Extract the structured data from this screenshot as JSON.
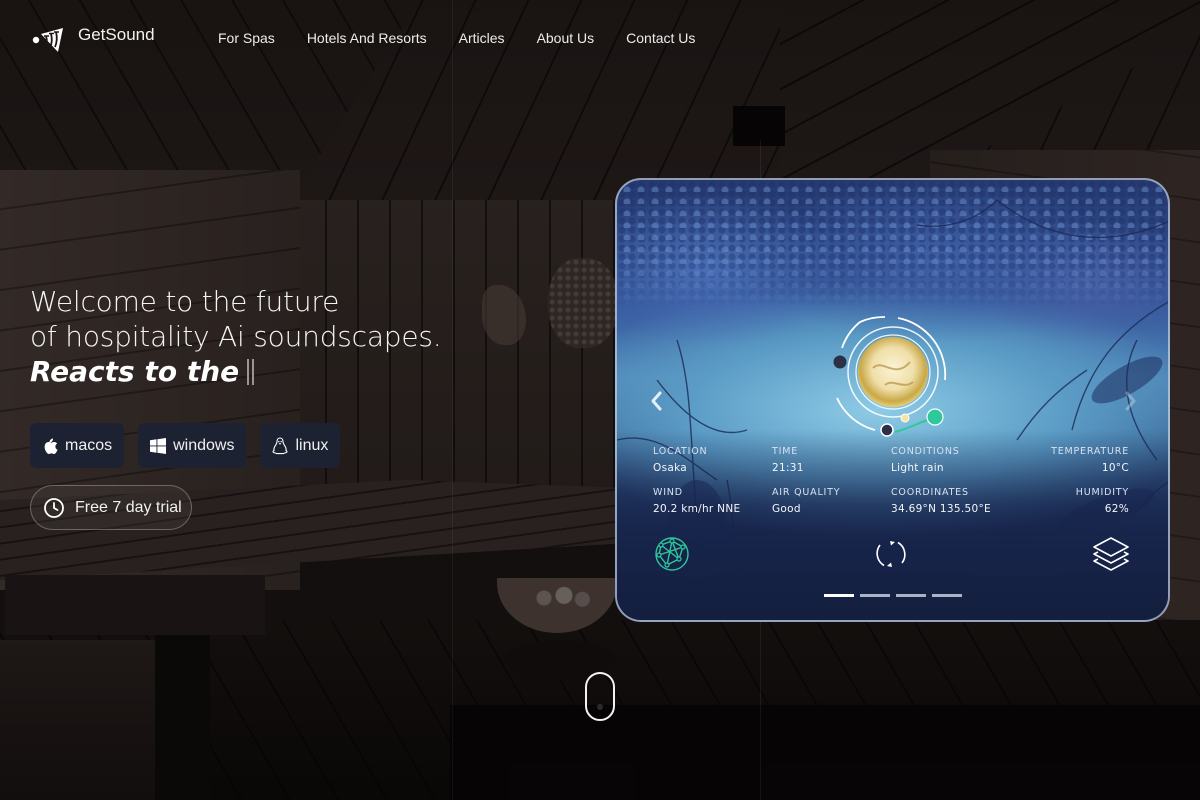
{
  "brand": {
    "name": "GetSound",
    "icon": "getsound-logo-icon"
  },
  "nav": {
    "items": [
      {
        "label": "For Spas"
      },
      {
        "label": "Hotels And Resorts"
      },
      {
        "label": "Articles"
      },
      {
        "label": "About Us"
      },
      {
        "label": "Contact Us"
      }
    ]
  },
  "hero": {
    "line1": "Welcome to the future",
    "line2": "of hospitality Ai soundscapes.",
    "typed": "Reacts to the",
    "cursor": "text-cursor"
  },
  "downloads": [
    {
      "label": "macos",
      "icon": "apple-icon"
    },
    {
      "label": "windows",
      "icon": "windows-icon"
    },
    {
      "label": "linux",
      "icon": "linux-penguin-icon"
    }
  ],
  "trial": {
    "label": "Free 7 day trial",
    "icon": "clock-icon"
  },
  "weather_card": {
    "stats": {
      "location": {
        "label": "LOCATION",
        "value": "Osaka"
      },
      "time": {
        "label": "TIME",
        "value": "21:31"
      },
      "conditions": {
        "label": "CONDITIONS",
        "value": "Light rain"
      },
      "temperature": {
        "label": "TEMPERATURE",
        "value": "10°C"
      },
      "wind": {
        "label": "WIND",
        "value": "20.2 km/hr NNE"
      },
      "air_quality": {
        "label": "AIR QUALITY",
        "value": "Good"
      },
      "coordinates": {
        "label": "COORDINATES",
        "value": "34.69°N 135.50°E"
      },
      "humidity": {
        "label": "HUMIDITY",
        "value": "62%"
      }
    },
    "icons": [
      "network-globe-icon",
      "refresh-icon",
      "layers-icon"
    ],
    "pager": {
      "total": 4,
      "active": 1
    },
    "colors": {
      "accent": "#2ec99a",
      "orb": "#f3e6b8"
    }
  }
}
